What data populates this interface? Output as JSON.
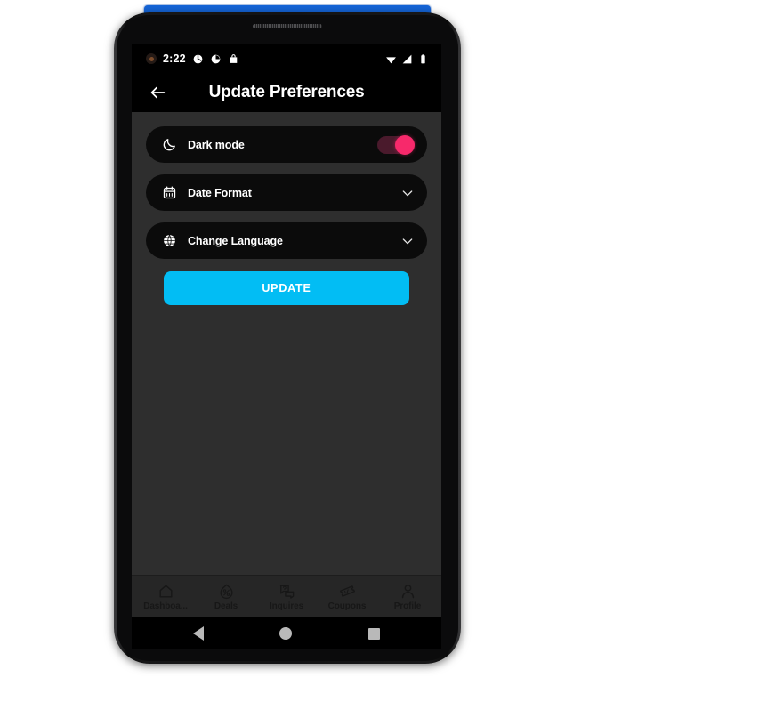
{
  "status_bar": {
    "time": "2:22",
    "left_icons": [
      "avatar-dot-icon",
      "app-notification-icon",
      "clock-notification-icon",
      "bag-notification-icon"
    ],
    "right_icons": [
      "wifi-icon",
      "cellular-signal-icon",
      "battery-icon"
    ]
  },
  "app_bar": {
    "back_icon": "arrow-left-icon",
    "title": "Update Preferences"
  },
  "preferences": [
    {
      "id": "dark-mode",
      "icon": "moon-icon",
      "label": "Dark mode",
      "control": "toggle",
      "value": "on"
    },
    {
      "id": "date-format",
      "icon": "calendar-icon",
      "label": "Date Format",
      "control": "dropdown",
      "trailing_icon": "chevron-down-icon"
    },
    {
      "id": "change-language",
      "icon": "globe-icon",
      "label": "Change Language",
      "control": "dropdown",
      "trailing_icon": "chevron-down-icon"
    }
  ],
  "update_button": {
    "label": "UPDATE"
  },
  "bottom_nav": [
    {
      "id": "dashboard",
      "icon": "home-icon",
      "label": "Dashboa..."
    },
    {
      "id": "deals",
      "icon": "deals-tag-icon",
      "label": "Deals"
    },
    {
      "id": "inquires",
      "icon": "chat-question-icon",
      "label": "Inquires"
    },
    {
      "id": "coupons",
      "icon": "coupon-ticket-icon",
      "label": "Coupons"
    },
    {
      "id": "profile",
      "icon": "person-icon",
      "label": "Profile"
    }
  ],
  "system_nav": {
    "back": "system-back-icon",
    "home": "system-home-icon",
    "recents": "system-recents-icon"
  },
  "colors": {
    "accent_blue": "#02bdf4",
    "toggle_on": "#f7296b",
    "toggle_track": "#4a1a2c",
    "content_bg": "#2e2e2e",
    "card_bg": "#0b0b0b",
    "device_strip": "#1565d8"
  }
}
